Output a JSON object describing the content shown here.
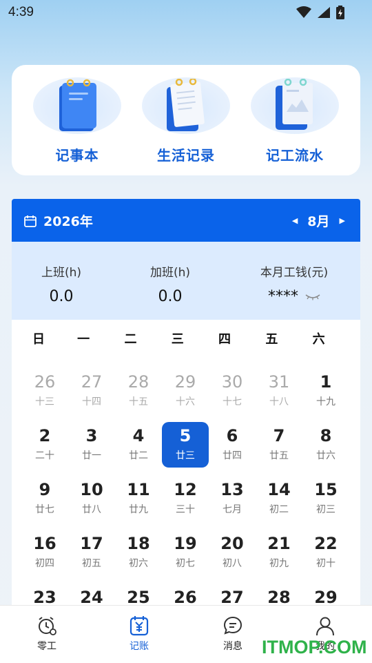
{
  "status_bar": {
    "time": "4:39"
  },
  "quick_actions": [
    {
      "label": "记事本"
    },
    {
      "label": "生活记录"
    },
    {
      "label": "记工流水"
    }
  ],
  "calendar": {
    "year": "2026年",
    "month": "8月",
    "summary": {
      "work_label": "上班(h)",
      "work_value": "0.0",
      "overtime_label": "加班(h)",
      "overtime_value": "0.0",
      "wage_label": "本月工钱(元)",
      "wage_value": "****"
    },
    "weekdays": [
      "日",
      "一",
      "二",
      "三",
      "四",
      "五",
      "六"
    ],
    "weeks": [
      [
        {
          "n": "26",
          "l": "十三",
          "o": true
        },
        {
          "n": "27",
          "l": "十四",
          "o": true
        },
        {
          "n": "28",
          "l": "十五",
          "o": true
        },
        {
          "n": "29",
          "l": "十六",
          "o": true
        },
        {
          "n": "30",
          "l": "十七",
          "o": true
        },
        {
          "n": "31",
          "l": "十八",
          "o": true
        },
        {
          "n": "1",
          "l": "十九"
        }
      ],
      [
        {
          "n": "2",
          "l": "二十"
        },
        {
          "n": "3",
          "l": "廿一"
        },
        {
          "n": "4",
          "l": "廿二"
        },
        {
          "n": "5",
          "l": "廿三",
          "s": true
        },
        {
          "n": "6",
          "l": "廿四"
        },
        {
          "n": "7",
          "l": "廿五"
        },
        {
          "n": "8",
          "l": "廿六"
        }
      ],
      [
        {
          "n": "9",
          "l": "廿七"
        },
        {
          "n": "10",
          "l": "廿八"
        },
        {
          "n": "11",
          "l": "廿九"
        },
        {
          "n": "12",
          "l": "三十"
        },
        {
          "n": "13",
          "l": "七月"
        },
        {
          "n": "14",
          "l": "初二"
        },
        {
          "n": "15",
          "l": "初三"
        }
      ],
      [
        {
          "n": "16",
          "l": "初四"
        },
        {
          "n": "17",
          "l": "初五"
        },
        {
          "n": "18",
          "l": "初六"
        },
        {
          "n": "19",
          "l": "初七"
        },
        {
          "n": "20",
          "l": "初八"
        },
        {
          "n": "21",
          "l": "初九"
        },
        {
          "n": "22",
          "l": "初十"
        }
      ],
      [
        {
          "n": "23",
          "l": ""
        },
        {
          "n": "24",
          "l": ""
        },
        {
          "n": "25",
          "l": ""
        },
        {
          "n": "26",
          "l": ""
        },
        {
          "n": "27",
          "l": ""
        },
        {
          "n": "28",
          "l": ""
        },
        {
          "n": "29",
          "l": ""
        }
      ]
    ]
  },
  "bottom_nav": [
    {
      "label": "零工",
      "icon": "alarm-clock-icon"
    },
    {
      "label": "记账",
      "icon": "ledger-icon",
      "active": true
    },
    {
      "label": "消息",
      "icon": "chat-bubble-icon"
    },
    {
      "label": "我的",
      "icon": "person-icon"
    }
  ],
  "watermark": "ITMOP.COM",
  "colors": {
    "accent": "#0a63ea",
    "selected": "#1560d6",
    "summary_bg": "#dcebfe"
  }
}
